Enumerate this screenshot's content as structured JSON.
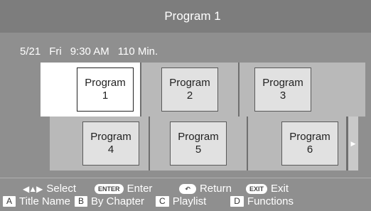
{
  "header": {
    "title": "Program 1"
  },
  "info": {
    "date": "5/21",
    "day": "Fri",
    "time": "9:30 AM",
    "duration": "110 Min."
  },
  "rows": [
    {
      "items": [
        {
          "line1": "Program",
          "line2": "1"
        },
        {
          "line1": "Program",
          "line2": "2"
        },
        {
          "line1": "Program",
          "line2": "3"
        }
      ]
    },
    {
      "items": [
        {
          "line1": "Program",
          "line2": "4"
        },
        {
          "line1": "Program",
          "line2": "5"
        },
        {
          "line1": "Program",
          "line2": "6"
        }
      ]
    }
  ],
  "legend": {
    "select": {
      "icon": "four-way-arrow-icon",
      "label": "Select"
    },
    "enter": {
      "key": "ENTER",
      "label": "Enter"
    },
    "return": {
      "icon": "return-icon",
      "label": "Return"
    },
    "exit": {
      "key": "EXIT",
      "label": "Exit"
    },
    "a": {
      "key": "A",
      "label": "Title Name"
    },
    "b": {
      "key": "B",
      "label": "By Chapter"
    },
    "c": {
      "key": "C",
      "label": "Playlist"
    },
    "d": {
      "key": "D",
      "label": "Functions"
    }
  },
  "colors": {
    "background": "#8f8f8f",
    "header": "#7d7d7d",
    "selected": "#ffffff",
    "cell": "#b9b9b9"
  }
}
